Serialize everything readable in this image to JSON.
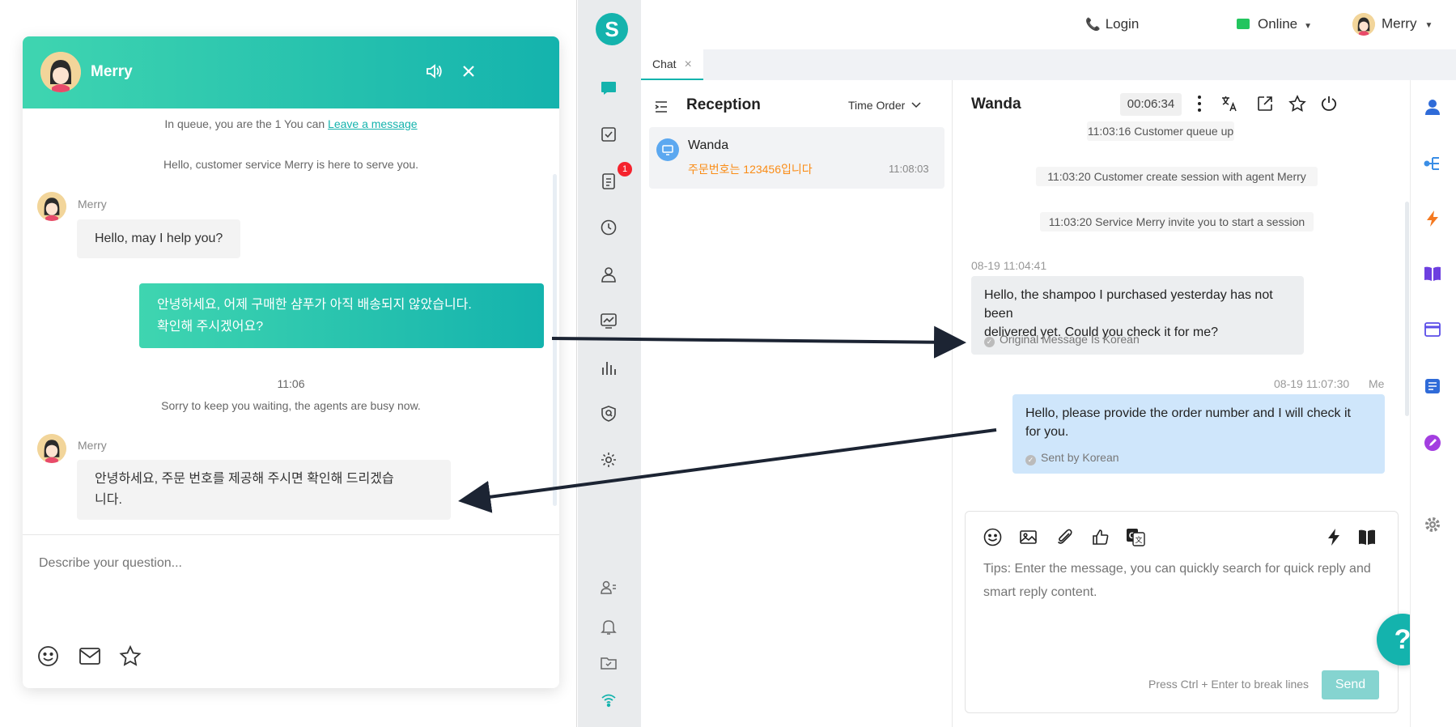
{
  "widget": {
    "agent_name": "Merry",
    "queue_text": "In queue, you are the 1 You can ",
    "leave_message": "Leave a message",
    "greeting": "Hello, customer service Merry is here to serve you.",
    "msg1_sender": "Merry",
    "msg1_text": "Hello, may I help you?",
    "msg2_line1": "안녕하세요, 어제 구매한 샴푸가 아직 배송되지 않았습니다.",
    "msg2_line2": "확인해 주시겠어요?",
    "time_1106": "11:06",
    "busy_text": "Sorry to keep you waiting, the agents are busy now.",
    "msg3_sender": "Merry",
    "msg3_line1": "안녕하세요, 주문 번호를 제공해 주시면 확인해 드리겠습",
    "msg3_line2": "니다.",
    "input_placeholder": "Describe your question..."
  },
  "topbar": {
    "login": "Login",
    "status": "Online",
    "user": "Merry"
  },
  "tabs": {
    "chat": "Chat",
    "close": "×"
  },
  "nav": {
    "badge": "1",
    "logo": "S"
  },
  "sessions": {
    "title": "Reception",
    "order": "Time Order",
    "card": {
      "name": "Wanda",
      "preview": "주문번호는 123456입니다",
      "time": "11:08:03"
    }
  },
  "conversation": {
    "name": "Wanda",
    "timer": "00:06:34",
    "events": [
      "11:03:16 Customer queue up",
      "11:03:20 Customer create session with agent Merry",
      "11:03:20 Service Merry invite you to start a session"
    ],
    "cust_time": "08-19 11:04:41",
    "cust_line1": "Hello, the shampoo I purchased yesterday has not been",
    "cust_line2": "delivered yet. Could you check it for me?",
    "cust_note": "Original Message Is Korean",
    "me_time": "08-19 11:07:30",
    "me_label": "Me",
    "me_line1": "Hello, please provide the order number and I will check it",
    "me_line2": "for you.",
    "me_note": "Sent by Korean"
  },
  "composer": {
    "placeholder": "Tips: Enter the message, you can quickly search for quick reply and smart reply content.",
    "hint": "Press Ctrl + Enter to break lines",
    "send": "Send"
  },
  "help": "?",
  "colors": {
    "accent": "#14b3ad",
    "gradient_start": "#3fd5b0",
    "me_bubble": "#cfe6fb",
    "badge": "#f5222d",
    "preview": "#fa8c16",
    "online": "#22c55e"
  }
}
